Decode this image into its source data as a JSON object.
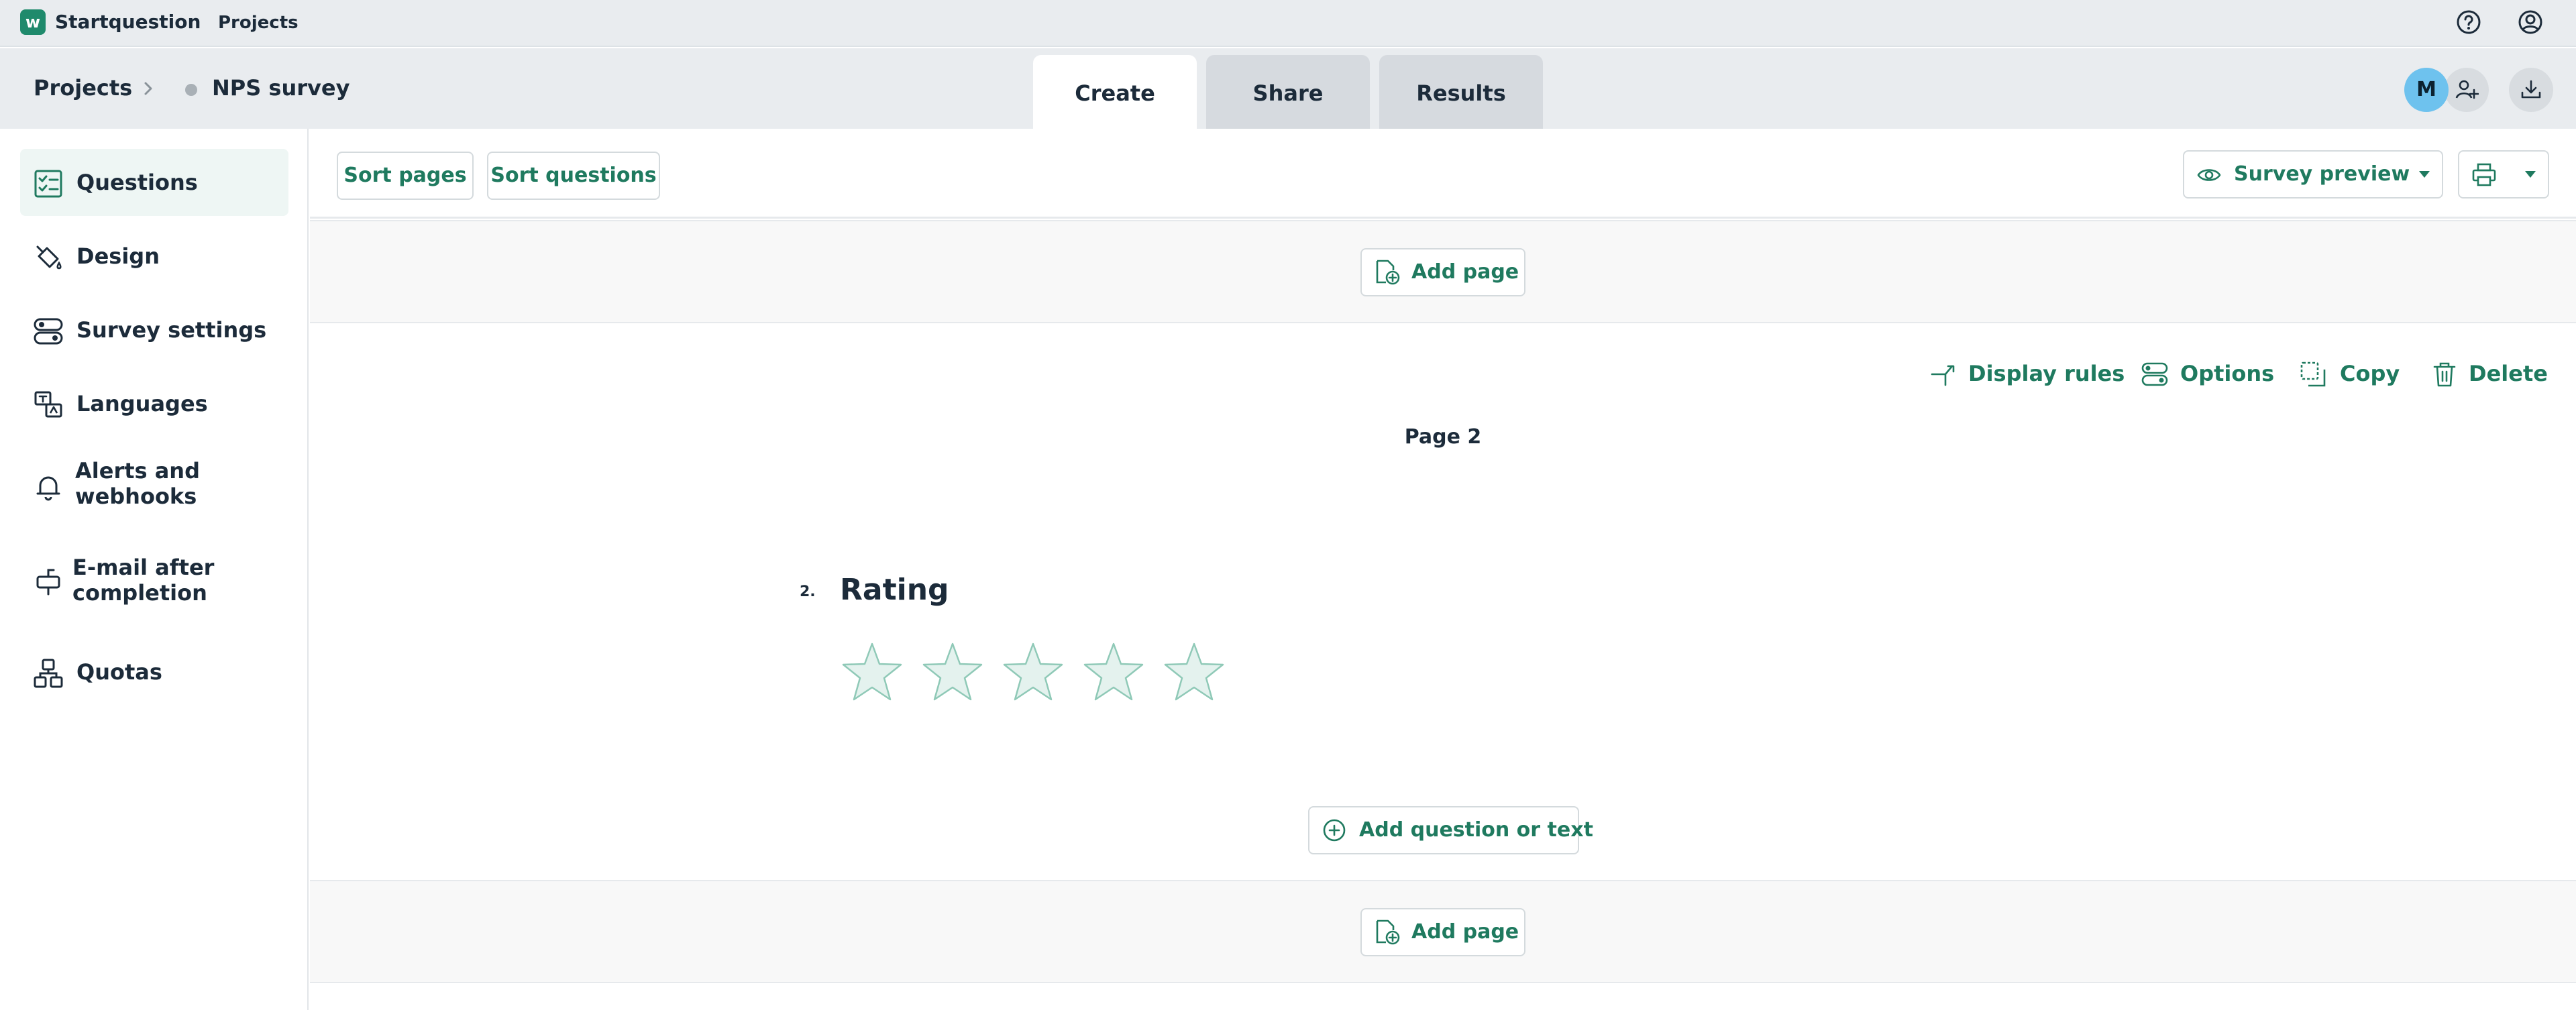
{
  "app": {
    "brand": "Startquestion",
    "logo_letter": "w",
    "top_link": "Projects"
  },
  "breadcrumb": {
    "root": "Projects",
    "current": "NPS survey"
  },
  "tabs": [
    {
      "label": "Create",
      "active": true
    },
    {
      "label": "Share",
      "active": false
    },
    {
      "label": "Results",
      "active": false
    }
  ],
  "user": {
    "avatar_initial": "M"
  },
  "sidebar": {
    "items": [
      {
        "label": "Questions",
        "icon": "checklist-icon",
        "active": true
      },
      {
        "label": "Design",
        "icon": "paint-bucket-icon",
        "active": false
      },
      {
        "label": "Survey settings",
        "icon": "toggles-icon",
        "active": false
      },
      {
        "label": "Languages",
        "icon": "translate-icon",
        "active": false
      },
      {
        "label": "Alerts and",
        "label2": "webhooks",
        "icon": "bell-icon",
        "active": false
      },
      {
        "label": "E-mail after",
        "label2": "completion",
        "icon": "mailbox-icon",
        "active": false
      },
      {
        "label": "Quotas",
        "icon": "hierarchy-icon",
        "active": false
      }
    ]
  },
  "toolbar": {
    "sort_pages": "Sort pages",
    "sort_questions": "Sort questions",
    "survey_preview": "Survey preview"
  },
  "page": {
    "add_page": "Add page",
    "actions": {
      "display_rules": "Display rules",
      "options": "Options",
      "copy": "Copy",
      "delete": "Delete"
    },
    "title": "Page 2",
    "question": {
      "number": "2.",
      "title": "Rating",
      "stars": 5
    },
    "add_question": "Add question or text"
  },
  "colors": {
    "accent": "#1f7a5f",
    "brand": "#1f8a6c",
    "avatar": "#6ec2ee",
    "star_fill": "#e4f2ee",
    "star_stroke": "#8fc9b7"
  }
}
